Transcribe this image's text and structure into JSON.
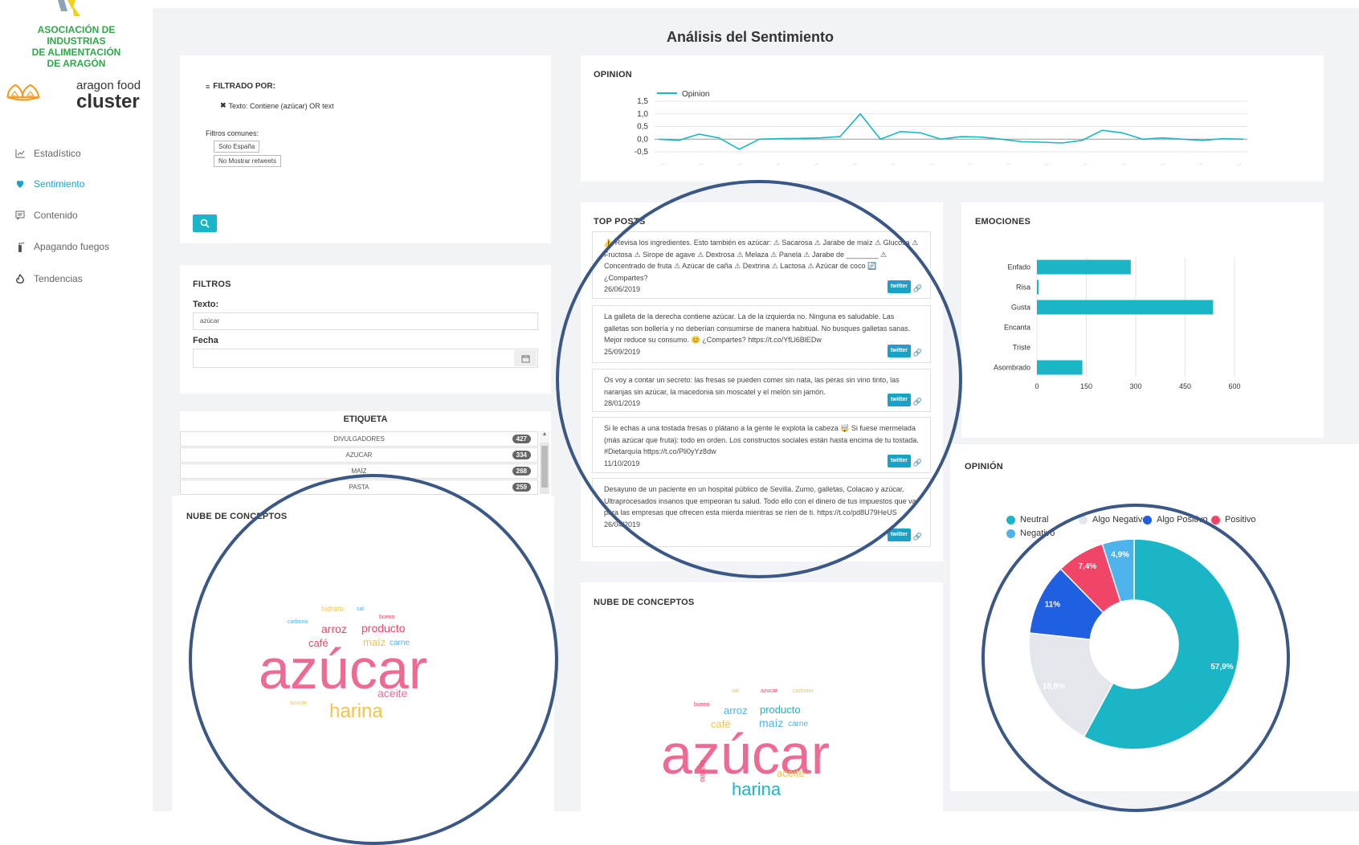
{
  "sidebar": {
    "assoc_lines": [
      "ASOCIACIÓN DE INDUSTRIAS",
      "DE ALIMENTACIÓN",
      "DE ARAGÓN"
    ],
    "cluster_small": "aragon food",
    "cluster_big": "cluster",
    "nav": [
      {
        "label": "Estadístico",
        "icon": "line-chart-icon"
      },
      {
        "label": "Sentimiento",
        "icon": "heart-shield-icon",
        "active": true
      },
      {
        "label": "Contenido",
        "icon": "comment-icon"
      },
      {
        "label": "Apagando fuegos",
        "icon": "extinguisher-icon"
      },
      {
        "label": "Tendencias",
        "icon": "fire-icon"
      }
    ]
  },
  "page_title": "Análisis del Sentimiento",
  "filter_card": {
    "heading": "FILTRADO POR:",
    "active_filter": "Texto: Contiene (azúcar) OR text",
    "common_label": "Filtros comunes:",
    "chips": [
      "Solo España",
      "No Mostrar retweets"
    ]
  },
  "filtros": {
    "title": "FILTROS",
    "texto_label": "Texto:",
    "texto_value": "azúcar",
    "fecha_label": "Fecha",
    "fecha_value": ""
  },
  "etiqueta": {
    "title": "ETIQUETA",
    "rows": [
      {
        "label": "DIVULGADORES",
        "count": "427"
      },
      {
        "label": "AZUCAR",
        "count": "334"
      },
      {
        "label": "MAÍZ",
        "count": "268"
      },
      {
        "label": "PASTA",
        "count": "259"
      }
    ]
  },
  "opinion_line": {
    "title": "OPINION",
    "legend": "Opinion",
    "y_ticks": [
      "1,5",
      "1,0",
      "0,5",
      "0,0",
      "-0,5"
    ],
    "color": "#1ab6c7"
  },
  "chart_data": [
    {
      "type": "line",
      "title": "OPINION",
      "series": [
        {
          "name": "Opinion",
          "values": [
            0.0,
            -0.05,
            0.2,
            0.05,
            -0.4,
            0.0,
            0.02,
            0.03,
            0.05,
            0.1,
            1.0,
            0.0,
            0.3,
            0.25,
            0.0,
            0.1,
            0.08,
            0.0,
            -0.1,
            -0.12,
            -0.15,
            -0.05,
            0.35,
            0.25,
            0.0,
            0.05,
            0.0,
            -0.05,
            0.02,
            0.0
          ]
        }
      ],
      "ylim": [
        -0.5,
        1.5
      ]
    },
    {
      "type": "bar",
      "title": "EMOCIONES",
      "categories": [
        "Enfado",
        "Risa",
        "Gusta",
        "Encanta",
        "Triste",
        "Asombrado"
      ],
      "values": [
        285,
        5,
        535,
        0,
        0,
        138
      ],
      "x_ticks": [
        "0",
        "150",
        "300",
        "450",
        "600"
      ],
      "xlim": [
        0,
        600
      ],
      "color": "#1ab6c7"
    },
    {
      "type": "pie",
      "title": "OPINIÓN",
      "categories": [
        "Neutral",
        "Algo Negativo",
        "Algo Positivo",
        "Positivo",
        "Negativo"
      ],
      "values": [
        57.9,
        18.8,
        11,
        7.4,
        4.9
      ],
      "labels": [
        "57,9%",
        "18,8%",
        "11%",
        "7,4%",
        "4,9%"
      ],
      "colors": [
        "#1ab6c7",
        "#e3e7eb",
        "#1f5fe0",
        "#ef4667",
        "#4db3ea"
      ]
    }
  ],
  "top_posts": {
    "title": "TOP POSTS",
    "posts": [
      {
        "text": "⚠️ Revisa los ingredientes. Esto también es azúcar: ⚠ Sacarosa ⚠ Jarabe de maíz ⚠ Glucosa ⚠ Fructosa ⚠ Sirope de agave ⚠ Dextrosa ⚠ Melaza ⚠ Panela ⚠ Jarabe de ________ ⚠ Concentrado de fruta ⚠ Azúcar de caña ⚠ Dextrina ⚠ Lactosa ⚠ Azúcar de coco 🔄 ¿Compartes?",
        "date": "26/06/2019",
        "source": "twitter"
      },
      {
        "text": "La galleta de la derecha contiene azúcar. La de la izquierda no. Ninguna es saludable. Las galletas son bollería y no deberían consumirse de manera habitual. No busques galletas sanas. Mejor reduce su consumo. 😊 ¿Compartes? https://t.co/YfLl6BlEDw",
        "date": "25/09/2019",
        "source": "twitter"
      },
      {
        "text": "Os voy a contar un secreto: las fresas se pueden comer sin nata, las peras sin vino tinto, las naranjas sin azúcar, la macedonia sin moscatel y el melón sin jamón.",
        "date": "28/01/2019",
        "source": "twitter"
      },
      {
        "text": "Si le echas a una tostada fresas o plátano a la gente le explota la cabeza 🤯 Si fuese mermelada (más azúcar que fruta): todo en orden. Los constructos sociales están hasta encima de tu tostada. #Dietarquía https://t.co/Pli0yYz8dw",
        "date": "11/10/2019",
        "source": "twitter"
      },
      {
        "text": "Desayuno de un paciente en un hospital público de Sevilla. Zumo, galletas, Colacao y azúcar. Ultraprocesados insanos que empeoran tu salud. Todo ello con el dinero de tus impuestos que va para las empresas que ofrecen esta mierda mientras se ríen de ti. https://t.co/pd8U79HeUS",
        "date": "26/04/2019",
        "source": "twitter"
      }
    ]
  },
  "emociones": {
    "title": "EMOCIONES"
  },
  "opinion_pie": {
    "title": "OPINIÓN"
  },
  "nube_left": {
    "title": "NUBE DE CONCEPTOS",
    "words": [
      {
        "t": "hidrato",
        "c": "#f4c24d"
      },
      {
        "t": "sal",
        "c": "#4db3ea"
      },
      {
        "t": "bueno",
        "c": "#ef4667"
      },
      {
        "t": "carbono",
        "c": "#4db3ea"
      },
      {
        "t": "arroz",
        "c": "#ef4667"
      },
      {
        "t": "producto",
        "c": "#ef4667"
      },
      {
        "t": "café",
        "c": "#ef4667"
      },
      {
        "t": "maíz",
        "c": "#f4c24d"
      },
      {
        "t": "carne",
        "c": "#4db3ea"
      },
      {
        "t": "azúcar",
        "c": "#ef6a93"
      },
      {
        "t": "aceite",
        "c": "#ef6a93"
      },
      {
        "t": "azucar",
        "c": "#f4c24d"
      },
      {
        "t": "harina",
        "c": "#f4c24d"
      }
    ]
  },
  "nube_mid": {
    "title": "NUBE DE CONCEPTOS",
    "words": [
      {
        "t": "sal",
        "c": "#f4c24d"
      },
      {
        "t": "azucar",
        "c": "#ef4667"
      },
      {
        "t": "carbono",
        "c": "#f4c24d"
      },
      {
        "t": "bueno",
        "c": "#ef4667"
      },
      {
        "t": "arroz",
        "c": "#4db3ea"
      },
      {
        "t": "producto",
        "c": "#1ab6c7"
      },
      {
        "t": "café",
        "c": "#f4c24d"
      },
      {
        "t": "maíz",
        "c": "#4db3ea"
      },
      {
        "t": "carne",
        "c": "#4db3ea"
      },
      {
        "t": "azúcar",
        "c": "#ef6a93"
      },
      {
        "t": "aceite",
        "c": "#f4c24d"
      },
      {
        "t": "hidrato",
        "c": "#ef4667"
      },
      {
        "t": "harina",
        "c": "#1ab6c7"
      }
    ]
  }
}
